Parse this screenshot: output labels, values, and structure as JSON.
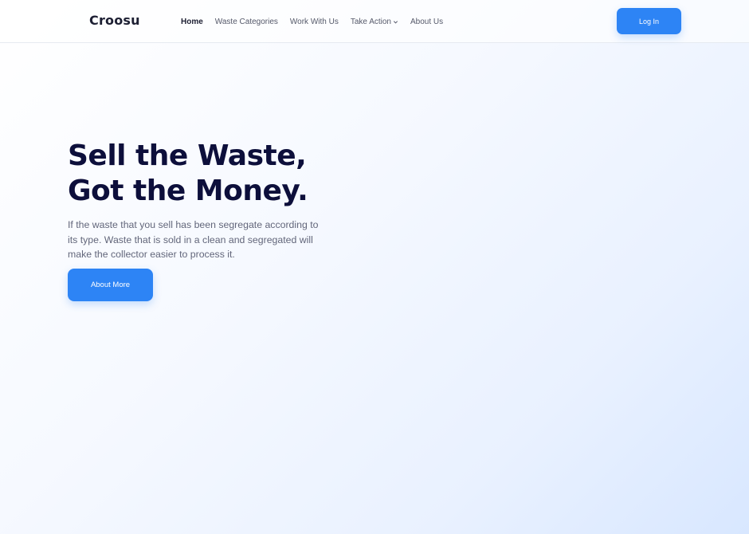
{
  "brand": {
    "name": "Croosu"
  },
  "nav": {
    "items": [
      {
        "label": "Home",
        "active": true
      },
      {
        "label": "Waste Categories"
      },
      {
        "label": "Work With Us"
      },
      {
        "label": "Take Action",
        "icon": "chevron-down-icon"
      },
      {
        "label": "About Us"
      }
    ],
    "login_label": "Log In"
  },
  "hero": {
    "title_line1": "Sell the Waste,",
    "title_line2": "Got the Money.",
    "description": "If the waste that you sell has been segregate according to its type. Waste that is sold in a clean and segregated will make the collector easier to process it.",
    "cta_label": "About More"
  },
  "colors": {
    "accent": "#2d84f5",
    "heading": "#0d0f3b",
    "body_text": "#62667a"
  }
}
